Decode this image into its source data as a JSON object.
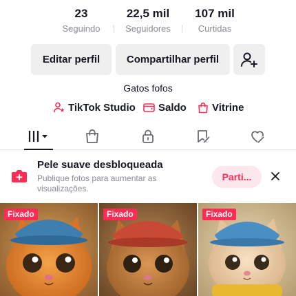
{
  "stats": [
    {
      "value": "23",
      "label": "Seguindo"
    },
    {
      "value": "22,5 mil",
      "label": "Seguidores"
    },
    {
      "value": "107 mil",
      "label": "Curtidas"
    }
  ],
  "actions": {
    "edit_label": "Editar perfil",
    "share_label": "Compartilhar perfil",
    "add_friend_icon": "person-add-icon"
  },
  "bio": "Gatos fofos",
  "links": [
    {
      "label": "TikTok Studio",
      "icon": "studio-icon",
      "color": "#fe2c55"
    },
    {
      "label": "Saldo",
      "icon": "wallet-icon",
      "color": "#fe2c55"
    },
    {
      "label": "Vitrine",
      "icon": "shopping-bag-icon",
      "color": "#fe2c55"
    }
  ],
  "tabs": [
    {
      "icon": "videos-grid-icon",
      "active": true
    },
    {
      "icon": "shop-bag-icon",
      "active": false
    },
    {
      "icon": "lock-icon",
      "active": false
    },
    {
      "icon": "saved-bookmark-icon",
      "active": false
    },
    {
      "icon": "liked-heart-icon",
      "active": false
    }
  ],
  "banner": {
    "title": "Pele suave desbloqueada",
    "description": "Publique fotos para aumentar as visualizações.",
    "button_label": "Parti...",
    "icon": "beauty-filter-icon"
  },
  "videos": [
    {
      "badge": "Fixado"
    },
    {
      "badge": "Fixado"
    },
    {
      "badge": "Fixado"
    }
  ],
  "colors": {
    "accent": "#fe2c55",
    "text": "#161823",
    "muted": "#8a8b91",
    "button_bg": "#efeff0"
  }
}
